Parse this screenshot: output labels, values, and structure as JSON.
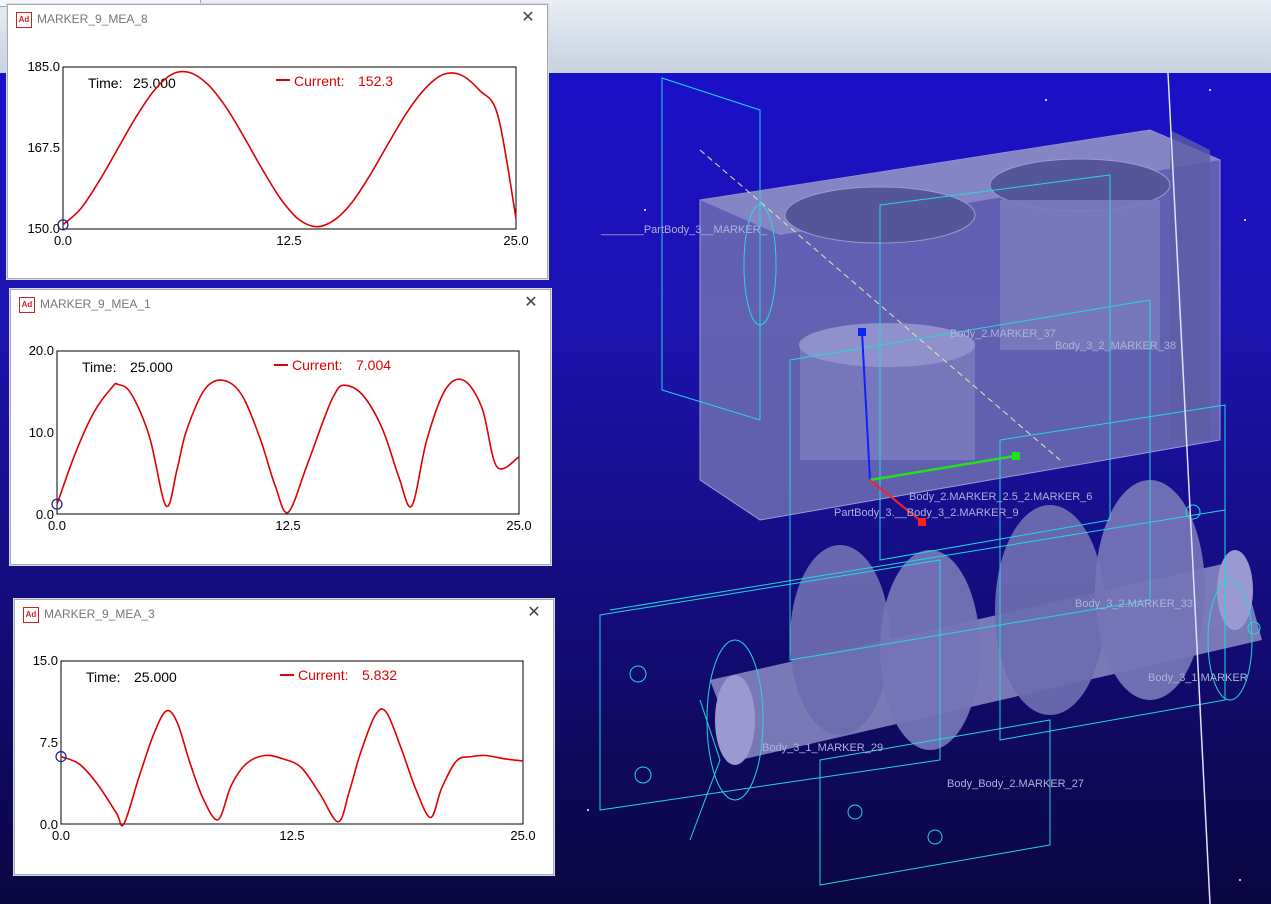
{
  "viewport": {
    "labels": [
      "_______PartBody_3__MARKER_",
      "Body_2.MARKER_37",
      "Body_3_2_MARKER_38",
      "Body_2.MARKER_2.5_2.MARKER_6",
      "PartBody_3.__Body_3_2.MARKER_9",
      "Body_3_2.MARKER_33",
      "Body_3_1_MARKER_29",
      "Body_Body_2.MARKER_27",
      "Body_3_1.MARKER"
    ]
  },
  "plots": [
    {
      "title": "MARKER_9_MEA_8",
      "time_label": "Time:",
      "time_value": "25.000",
      "current_label": "Current:",
      "current_value": "152.3",
      "y_ticks": [
        "185.0",
        "167.5",
        "150.0"
      ],
      "x_ticks": [
        "0.0",
        "12.5",
        "25.0"
      ]
    },
    {
      "title": "MARKER_9_MEA_1",
      "time_label": "Time:",
      "time_value": "25.000",
      "current_label": "Current:",
      "current_value": "7.004",
      "y_ticks": [
        "20.0",
        "10.0",
        "0.0"
      ],
      "x_ticks": [
        "0.0",
        "12.5",
        "25.0"
      ]
    },
    {
      "title": "MARKER_9_MEA_3",
      "time_label": "Time:",
      "time_value": "25.000",
      "current_label": "Current:",
      "current_value": "5.832",
      "y_ticks": [
        "15.0",
        "7.5",
        "0.0"
      ],
      "x_ticks": [
        "0.0",
        "12.5",
        "25.0"
      ]
    }
  ],
  "chart_data": [
    {
      "type": "line",
      "xlim": [
        0,
        25
      ],
      "ylim": [
        150,
        185
      ],
      "x": [
        0,
        1,
        2,
        3,
        4,
        5,
        6,
        7,
        8,
        9,
        10,
        11,
        12,
        13,
        14,
        15,
        16,
        17,
        18,
        19,
        20,
        21,
        22,
        23,
        24,
        25
      ],
      "y": [
        150.9,
        154.5,
        160.4,
        167.2,
        174.0,
        179.8,
        183.4,
        183.8,
        181.2,
        176.3,
        169.8,
        162.9,
        156.6,
        152.1,
        150.5,
        152.0,
        156.0,
        162.0,
        168.8,
        175.3,
        180.4,
        183.4,
        183.2,
        179.9,
        174.5,
        152.3
      ],
      "series_color": "#e00000"
    },
    {
      "type": "line",
      "xlim": [
        0,
        25
      ],
      "ylim": [
        0,
        20
      ],
      "x": [
        0,
        1,
        2,
        3,
        3.3,
        4,
        5,
        5.9,
        6.5,
        7,
        8,
        9,
        10,
        11,
        11.8,
        12.5,
        13.5,
        14.5,
        15,
        15.5,
        16.5,
        17.6,
        18.5,
        19.2,
        20,
        21,
        22,
        23,
        23.8,
        25
      ],
      "y": [
        1.2,
        7.5,
        12.5,
        15.6,
        15.9,
        14.8,
        9.5,
        1.0,
        5.5,
        10.2,
        15.3,
        16.4,
        14.6,
        9.2,
        3.5,
        0.2,
        5.8,
        12.0,
        14.6,
        15.8,
        14.7,
        10.5,
        4.5,
        1.0,
        9.0,
        15.2,
        16.4,
        13.0,
        5.8,
        7.0
      ],
      "series_color": "#e00000"
    },
    {
      "type": "line",
      "xlim": [
        0,
        25
      ],
      "ylim": [
        0,
        15
      ],
      "x": [
        0,
        1,
        2,
        3,
        3.4,
        4.2,
        5,
        5.7,
        6.3,
        7,
        7.7,
        8.5,
        9.2,
        10,
        11,
        12,
        13,
        14,
        15,
        15.6,
        16.2,
        17,
        17.6,
        18.4,
        19.2,
        20,
        20.6,
        21.4,
        22.2,
        23,
        24,
        25
      ],
      "y": [
        6.2,
        5.5,
        3.6,
        1.0,
        0.0,
        4.2,
        8.2,
        10.4,
        9.3,
        5.5,
        2.3,
        0.4,
        3.5,
        5.5,
        6.3,
        6.0,
        5.2,
        2.8,
        0.2,
        3.0,
        6.5,
        10.0,
        10.3,
        7.0,
        3.2,
        0.6,
        3.3,
        5.8,
        6.2,
        6.3,
        6.0,
        5.8
      ],
      "series_color": "#e00000"
    }
  ]
}
